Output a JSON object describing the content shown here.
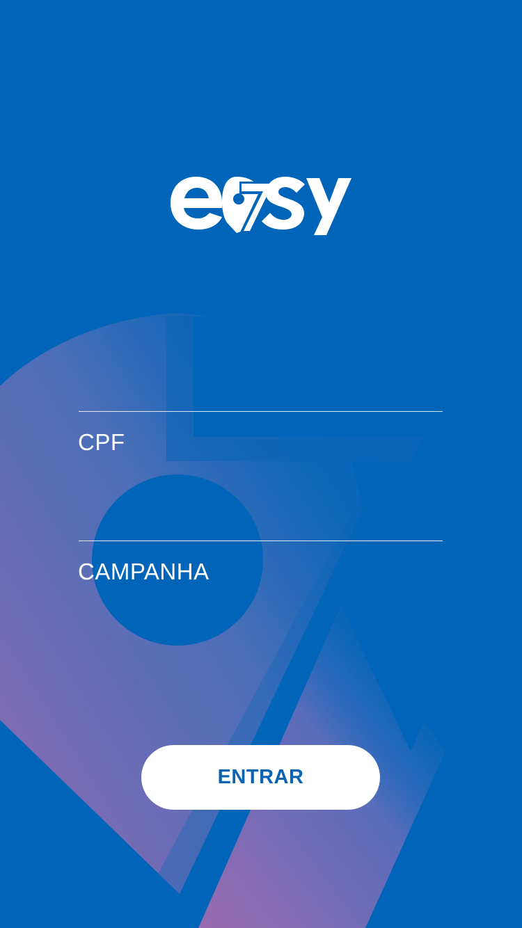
{
  "brand": {
    "logo_text": "easy",
    "logo_icon": "location-pin-seven-icon"
  },
  "form": {
    "cpf_label": "CPF",
    "campanha_label": "CAMPANHA",
    "enter_button_label": "ENTRAR"
  },
  "colors": {
    "background": "#0065b8",
    "accent_purple": "#8f6ab5",
    "button_background": "#ffffff",
    "button_text": "#0b63b3"
  }
}
